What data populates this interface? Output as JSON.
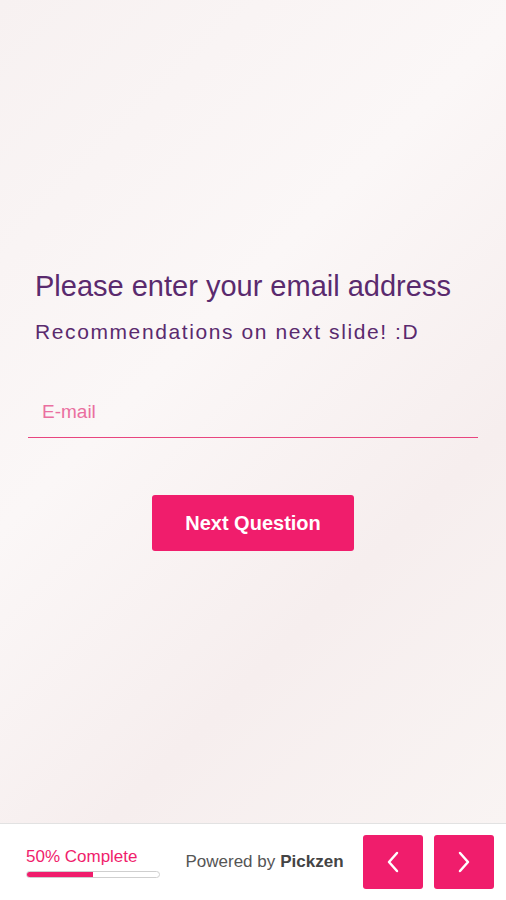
{
  "question": {
    "title": "Please enter your email address",
    "subtitle": "Recommendations on next slide! :D"
  },
  "email_field": {
    "placeholder": "E-mail"
  },
  "next_button": {
    "label": "Next Question"
  },
  "footer": {
    "progress": {
      "label": "50% Complete",
      "level": 0.5
    },
    "powered_by": "Powered by",
    "brand": "Pickzen"
  }
}
